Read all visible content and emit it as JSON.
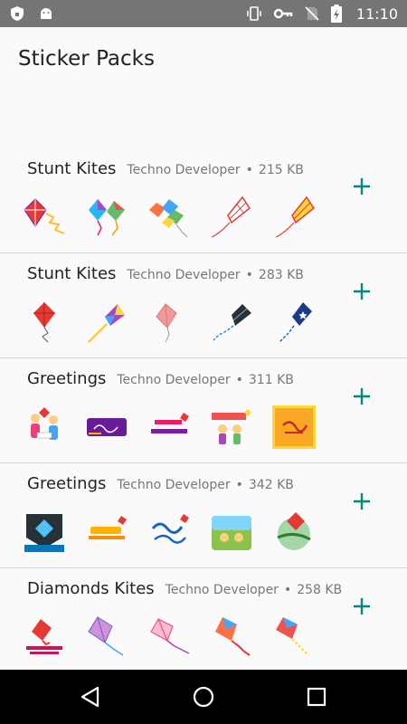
{
  "status_bar": {
    "time": "11:10"
  },
  "app": {
    "title": "Sticker Packs"
  },
  "colors": {
    "accent": "#00897b",
    "status_bar": "#757575",
    "nav_bar": "#000000"
  },
  "packs": [
    {
      "name": "Stunt Kites",
      "publisher": "Techno Developer",
      "size": "215 KB"
    },
    {
      "name": "Stunt Kites",
      "publisher": "Techno Developer",
      "size": "283 KB"
    },
    {
      "name": "Greetings",
      "publisher": "Techno Developer",
      "size": "311 KB"
    },
    {
      "name": "Greetings",
      "publisher": "Techno Developer",
      "size": "342 KB"
    },
    {
      "name": "Diamonds Kites",
      "publisher": "Techno Developer",
      "size": "258 KB"
    }
  ],
  "icons": {
    "status_left": [
      "shield-icon",
      "android-icon"
    ],
    "status_right": [
      "vibrate-icon",
      "key-icon",
      "no-sim-icon",
      "battery-charging-icon"
    ],
    "nav": [
      "back-icon",
      "home-icon",
      "recents-icon"
    ],
    "add": "plus-icon"
  }
}
